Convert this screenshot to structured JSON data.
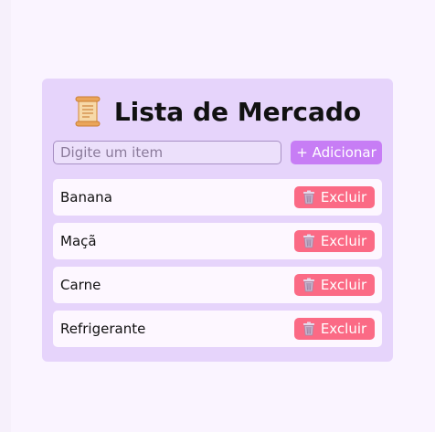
{
  "app": {
    "title": "Lista de Mercado",
    "title_icon": "scroll-icon"
  },
  "form": {
    "input_value": "",
    "input_placeholder": "Digite um item",
    "add_button_label": "+ Adicionar"
  },
  "items": [
    {
      "label": "Banana",
      "delete_label": "Excluir",
      "delete_icon": "trash-icon"
    },
    {
      "label": "Maçã",
      "delete_label": "Excluir",
      "delete_icon": "trash-icon"
    },
    {
      "label": "Carne",
      "delete_label": "Excluir",
      "delete_icon": "trash-icon"
    },
    {
      "label": "Refrigerante",
      "delete_label": "Excluir",
      "delete_icon": "trash-icon"
    }
  ],
  "colors": {
    "page_background": "#faf4ff",
    "card_background": "#e6d4fb",
    "add_button": "#c77df5",
    "delete_button": "#fb6a85",
    "item_background": "#fdf7ff"
  }
}
